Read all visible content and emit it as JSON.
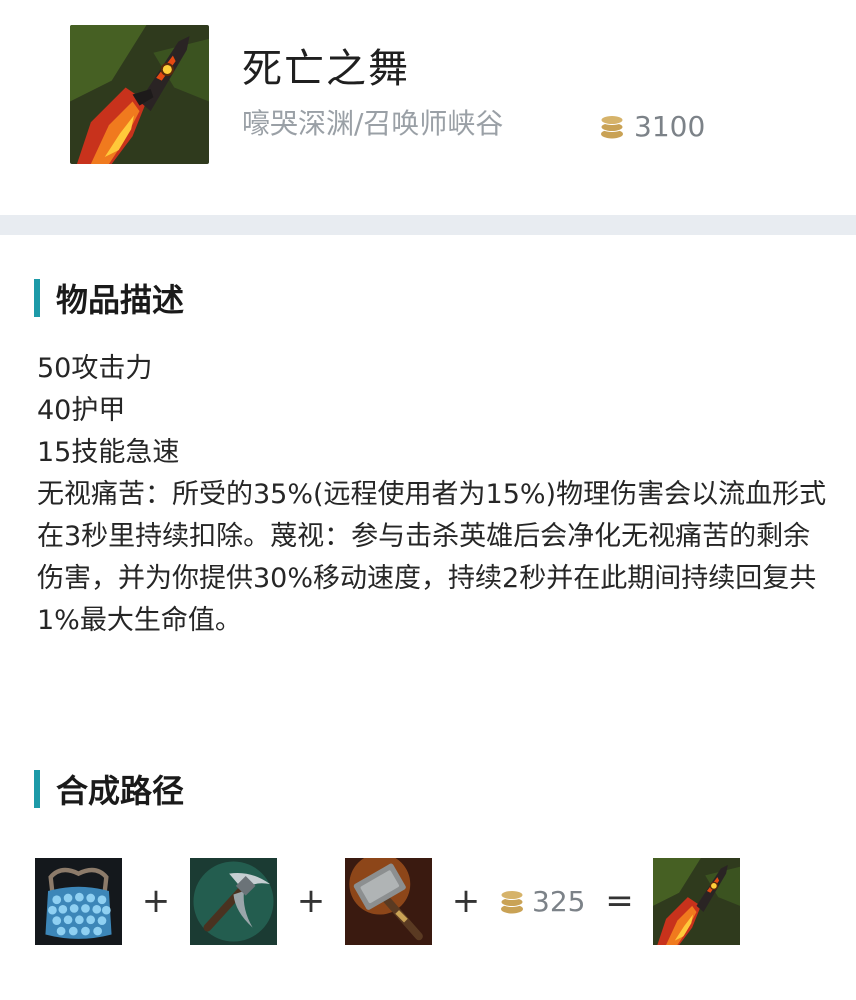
{
  "item": {
    "name": "死亡之舞",
    "maps": "嚎哭深渊/召唤师峡谷",
    "price": "3100",
    "icon": "deaths-dance-icon"
  },
  "description": {
    "title": "物品描述",
    "stats": [
      "50攻击力",
      "40护甲",
      "15技能急速"
    ],
    "passive": "无视痛苦：所受的35%(远程使用者为15%)物理伤害会以流血形式在3秒里持续扣除。蔑视：参与击杀英雄后会净化无视痛苦的剩余伤害，并为你提供30%移动速度，持续2秒并在此期间持续回复共1%最大生命值。"
  },
  "recipe": {
    "title": "合成路径",
    "components": [
      {
        "icon": "chain-vest-icon"
      },
      {
        "icon": "pickaxe-icon"
      },
      {
        "icon": "caulfields-warhammer-icon"
      }
    ],
    "plus": "+",
    "equals": "=",
    "combine_cost": "325",
    "result_icon": "deaths-dance-icon"
  },
  "colors": {
    "accent": "#1d9aa8",
    "divider": "#e8ecf1",
    "gold": "#c9a255"
  }
}
